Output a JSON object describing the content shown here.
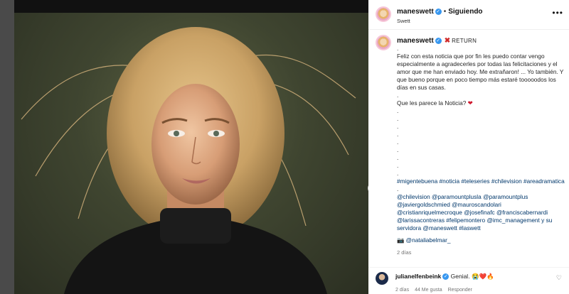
{
  "post": {
    "username": "maneswett",
    "follow_status": "Siguiendo",
    "subtitle": "Swett",
    "more_icon": "more-options-icon",
    "return_label": "RETURN"
  },
  "caption": {
    "username": "maneswett",
    "paragraph": "Feliz con esta noticia que por fin les puedo contar vengo especialmente a agradecerles por todas las felicitaciones y el amor que me han enviado hoy. Me extrañaron! ... Yo también. Y que bueno porque en poco tiempo más estaré tooooodos los días en sus casas.",
    "question": "Que les parece la Noticia?",
    "hashtags": "#migentebuena #noticia #teleseries #chilevision #areadramatica",
    "mention_lines": [
      "@chilevision @paramountplusla @paramountplus",
      "@javiergoldschmied @mauroscandolari",
      "@cristianriquelmecroque @josefinafc @franciscabernardi",
      "@larissacontreras #felipemontero @imc_management y su",
      "servidora @maneswett #laswett"
    ],
    "photo_credit": "@nataliabelmar_",
    "time": "2 días"
  },
  "comment": {
    "username": "julianelfenbeink",
    "text": "Genial.",
    "emojis": "😭❤️🔥",
    "time": "2 días",
    "likes": "44 Me gusta",
    "reply": "Responder"
  },
  "colors": {
    "link": "#00376b",
    "verified": "#3797f0",
    "heart": "#d0182e"
  }
}
